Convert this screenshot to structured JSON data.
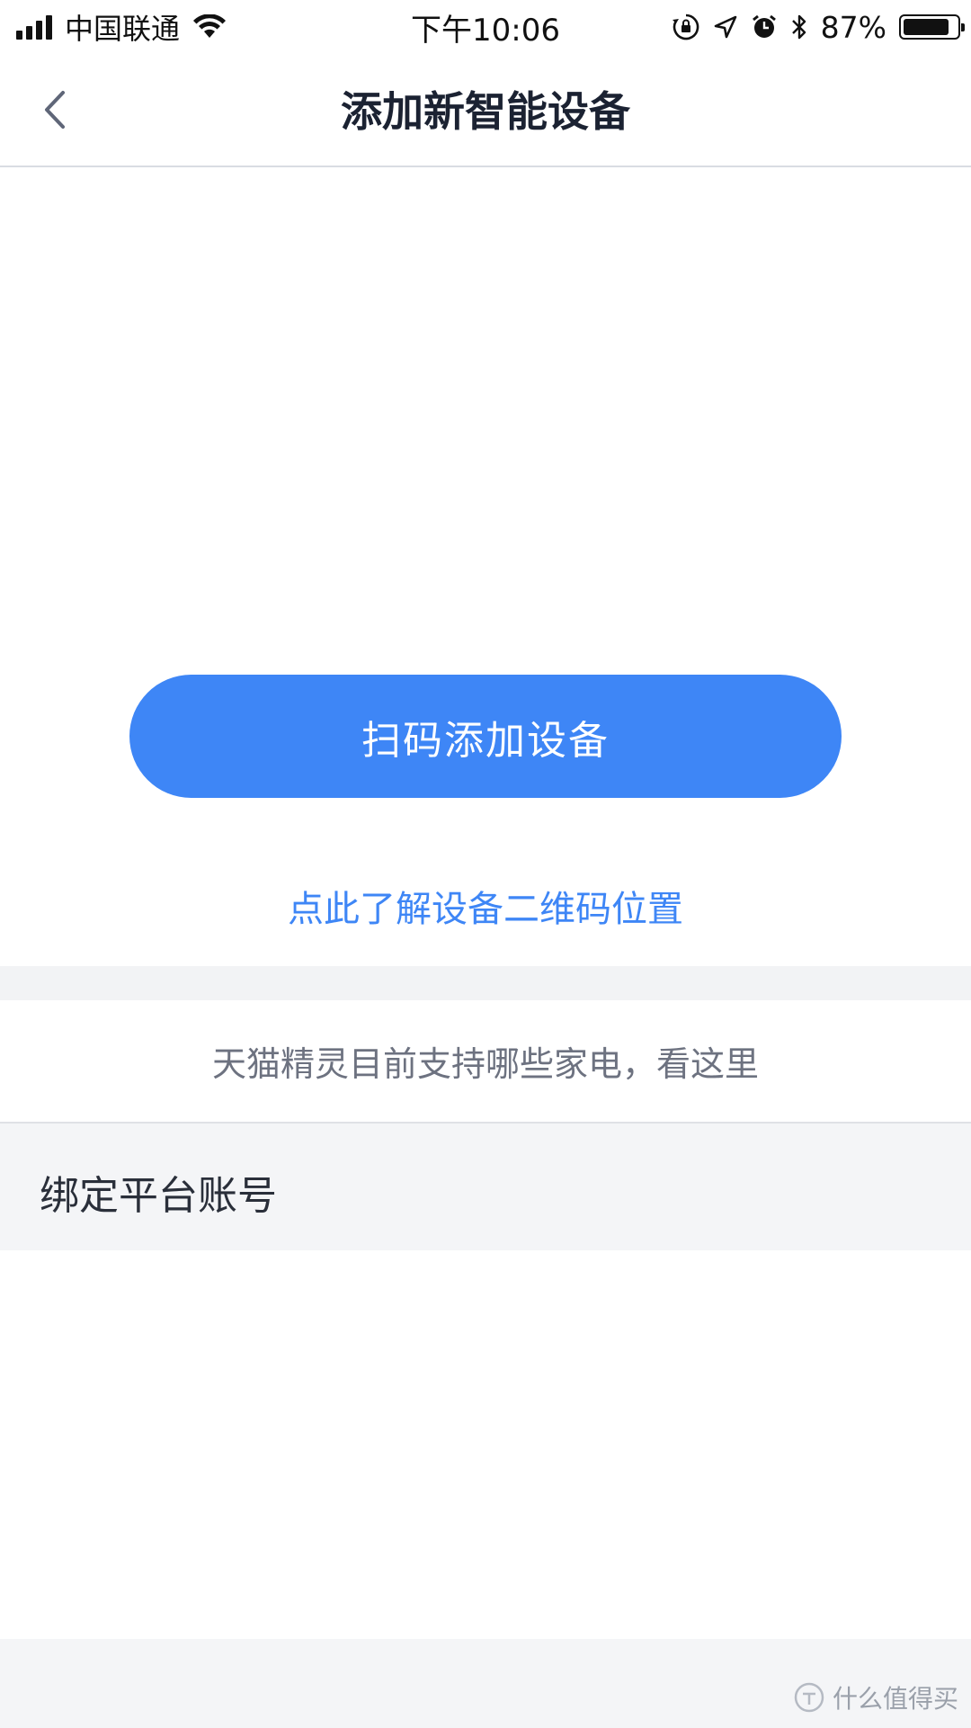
{
  "status_bar": {
    "carrier": "中国联通",
    "time": "下午10:06",
    "battery_percent": "87%",
    "battery_level": 0.87,
    "icons": [
      "signal-icon",
      "wifi-icon",
      "orientation-lock-icon",
      "location-icon",
      "alarm-icon",
      "bluetooth-icon",
      "battery-icon"
    ]
  },
  "nav": {
    "title": "添加新智能设备",
    "back_icon": "chevron-left-icon"
  },
  "main": {
    "scan_button_label": "扫码添加设备",
    "qr_help_link": "点此了解设备二维码位置",
    "supported_appliances_link": "天猫精灵目前支持哪些家电，看这里",
    "bind_section_title": "绑定平台账号"
  },
  "watermark": {
    "text": "什么值得买"
  },
  "colors": {
    "accent": "#3e86f6",
    "section_bg": "#f4f5f7",
    "title_text": "#1b2232",
    "muted_text": "#6d7280"
  }
}
